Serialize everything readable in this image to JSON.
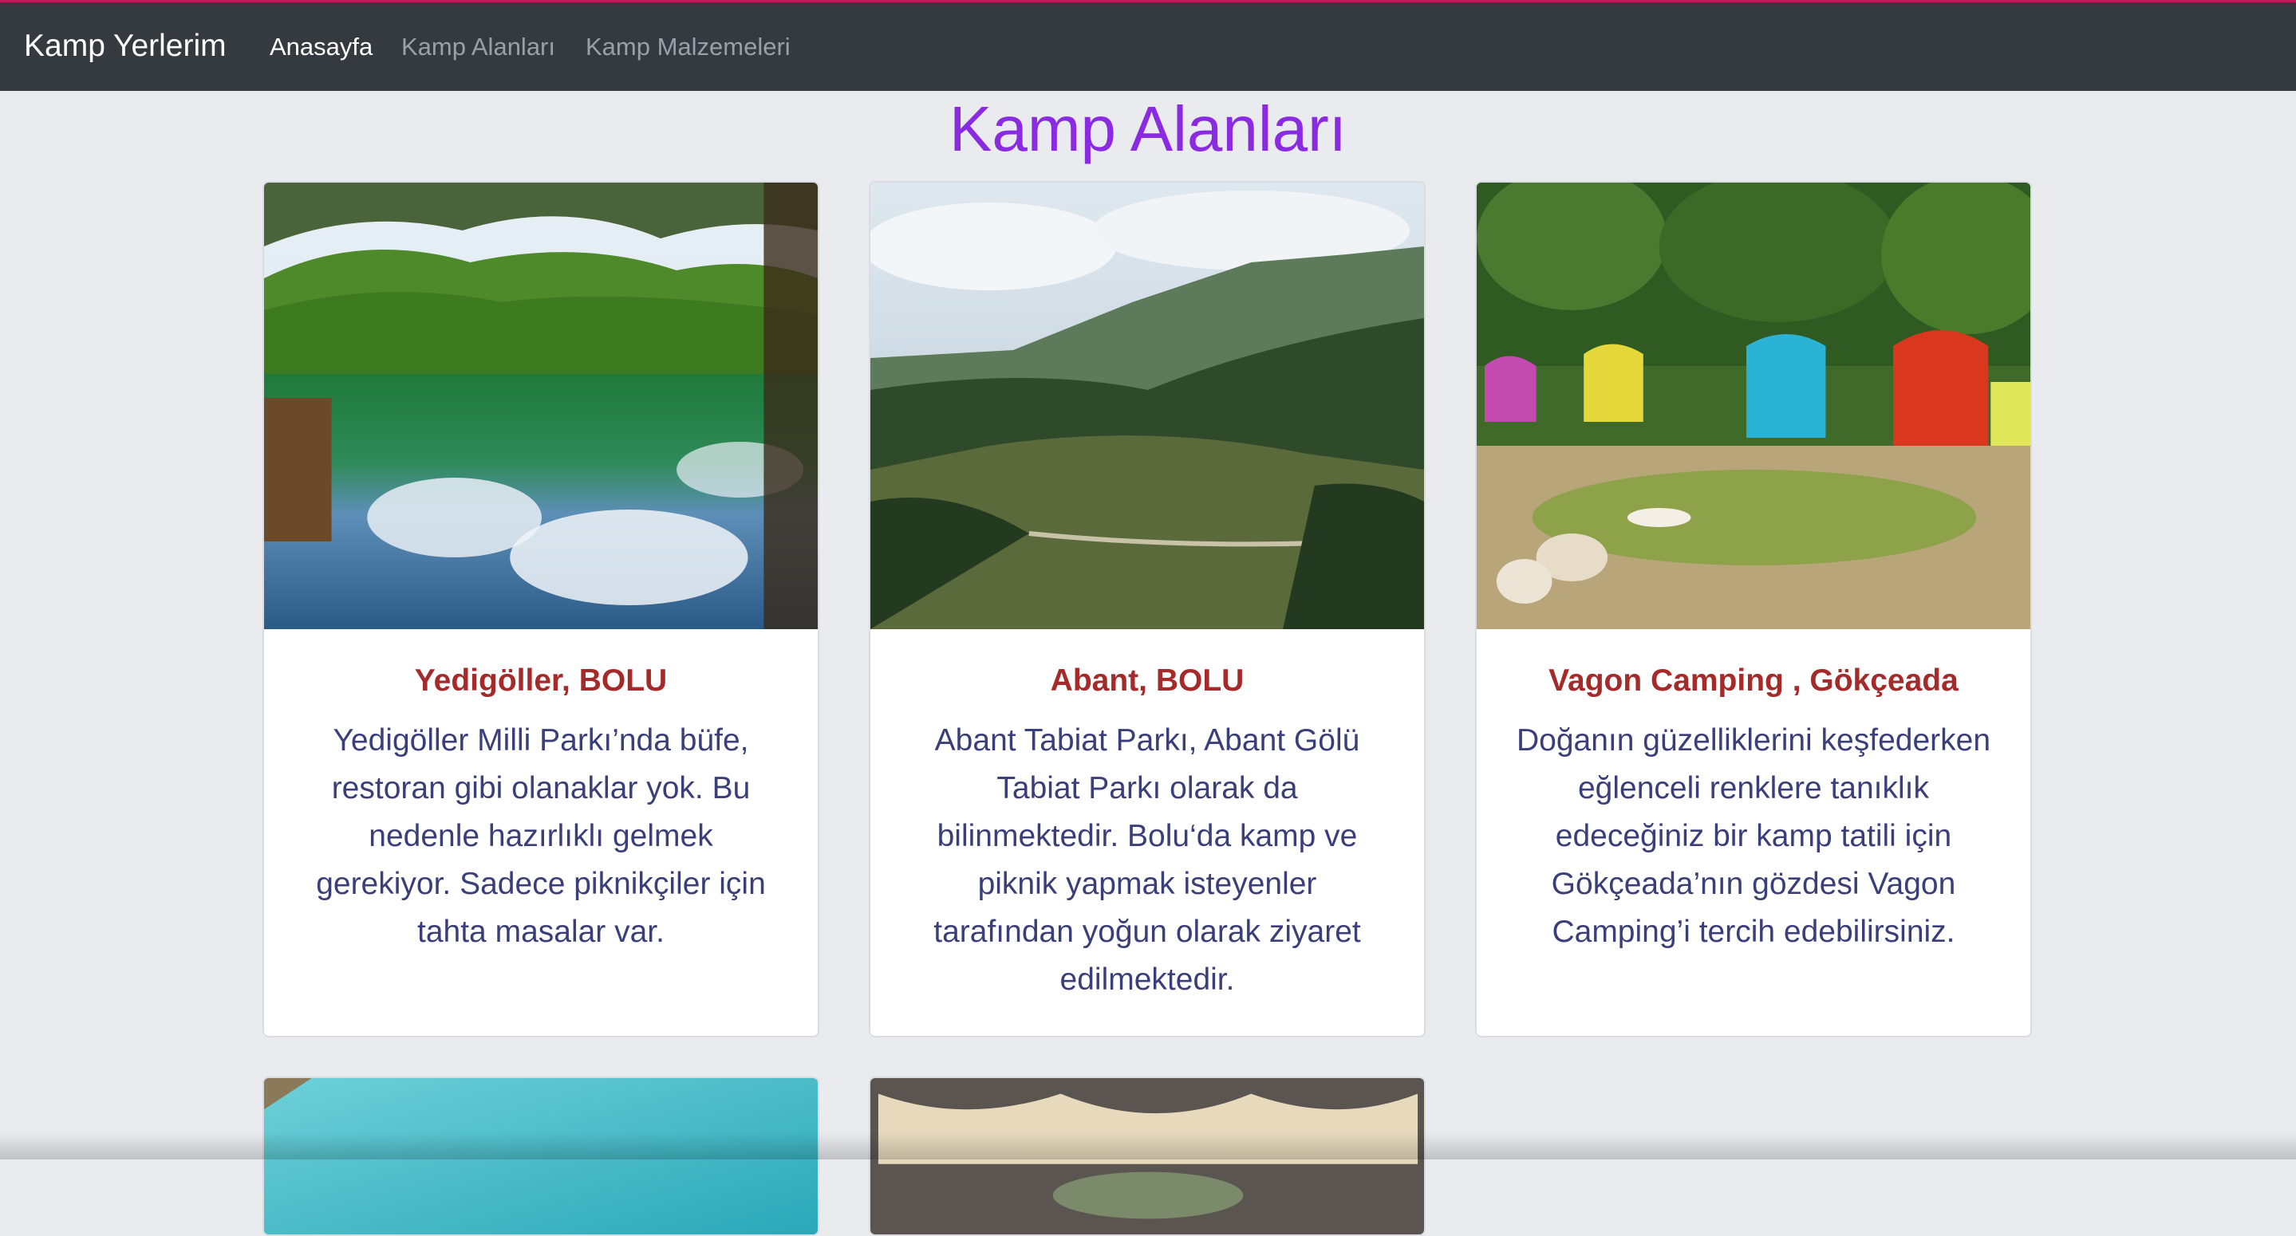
{
  "navbar": {
    "brand": "Kamp Yerlerim",
    "links": [
      {
        "label": "Anasayfa",
        "active": true
      },
      {
        "label": "Kamp Alanları",
        "active": false
      },
      {
        "label": "Kamp Malzemeleri",
        "active": false
      }
    ]
  },
  "page": {
    "title": "Kamp Alanları"
  },
  "cards": [
    {
      "title": "Yedigöller, BOLU",
      "text": "Yedigöller Milli Parkı’nda büfe, restoran gibi olanaklar yok. Bu nedenle hazırlıklı gelmek gerekiyor. Sadece piknikçiler için tahta masalar var.",
      "image": "lake-forest-reflection-photo"
    },
    {
      "title": "Abant, BOLU",
      "text": "Abant Tabiat Parkı, Abant Gölü Tabiat Parkı olarak da bilinmektedir. Bolu‘da kamp ve piknik yapmak isteyenler tarafından yoğun olarak ziyaret edilmektedir.",
      "image": "mountain-valley-forest-photo"
    },
    {
      "title": "Vagon Camping , Gökçeada",
      "text": "Doğanın güzelliklerini keşfederken eğlenceli renklere tanıklık edeceğiniz bir kamp tatili için Gökçeada’nın gözdesi Vagon Camping’i tercih edebilirsiniz.",
      "image": "colorful-wagon-huts-photo"
    }
  ],
  "partial_cards": [
    {
      "image": "turquoise-water-photo"
    },
    {
      "image": "canopy-tent-photo"
    }
  ],
  "colors": {
    "navbar_bg": "#343a40",
    "page_bg": "#e9ebef",
    "title": "#8a2be2",
    "card_title": "#a52a2a",
    "card_text": "#3b3f79"
  }
}
